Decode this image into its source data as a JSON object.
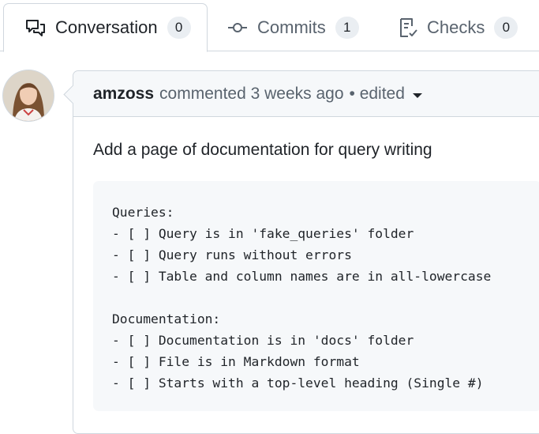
{
  "tabs": [
    {
      "label": "Conversation",
      "count": "0",
      "icon": "conversation-icon"
    },
    {
      "label": "Commits",
      "count": "1",
      "icon": "commit-icon"
    },
    {
      "label": "Checks",
      "count": "0",
      "icon": "checklist-icon"
    }
  ],
  "comment": {
    "author": "amzoss",
    "action": "commented 3 weeks ago",
    "edited": "• edited",
    "description": "Add a page of documentation for query writing",
    "code_lines": [
      "Queries:",
      "- [ ] Query is in 'fake_queries' folder",
      "- [ ] Query runs without errors",
      "- [ ] Table and column names are in all-lowercase",
      "",
      "Documentation:",
      "- [ ] Documentation is in 'docs' folder",
      "- [ ] File is in Markdown format",
      "- [ ] Starts with a top-level heading (Single #)"
    ]
  },
  "colors": {
    "border": "#d0d7de",
    "header_bg": "#f6f8fa",
    "counter_bg": "#eaeef2",
    "muted_text": "#59636e"
  }
}
